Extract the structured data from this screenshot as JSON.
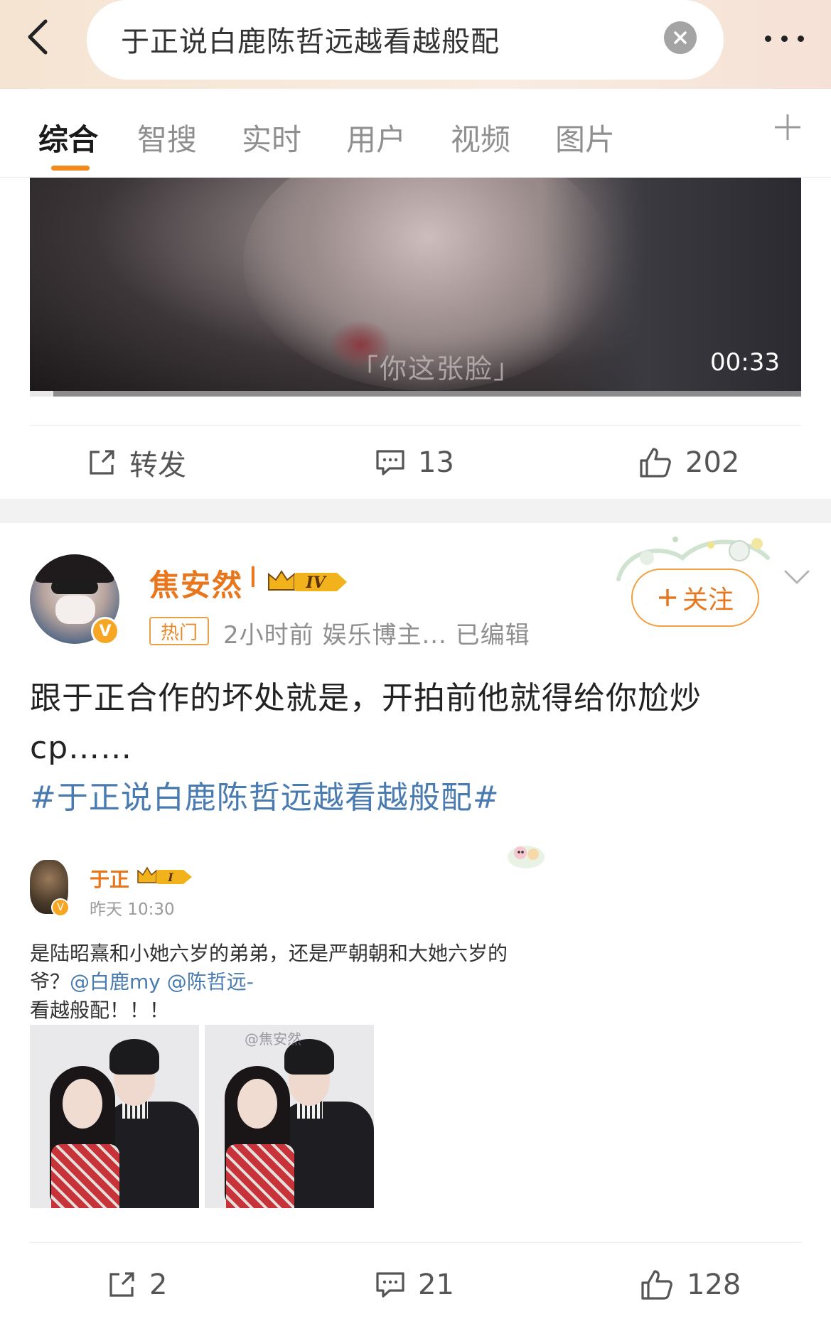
{
  "header": {
    "search_query": "于正说白鹿陈哲远越看越般配",
    "back_icon": "chevron-left-icon",
    "clear_icon": "close-icon",
    "more_icon": "more-dots-icon"
  },
  "tabs": {
    "items": [
      {
        "label": "综合",
        "active": true
      },
      {
        "label": "智搜",
        "active": false
      },
      {
        "label": "实时",
        "active": false
      },
      {
        "label": "用户",
        "active": false
      },
      {
        "label": "视频",
        "active": false
      },
      {
        "label": "图片",
        "active": false
      }
    ],
    "add_icon": "plus-icon",
    "accent_color": "#f28b1e"
  },
  "video": {
    "subtitle": "「你这张脸」",
    "duration": "00:33",
    "progress": 0.03
  },
  "post1_actions": {
    "repost_label": "转发",
    "comments": "13",
    "likes": "202"
  },
  "post2": {
    "username": "焦安然",
    "username_suffix": "I",
    "vip_level": "IV",
    "hot_badge": "热门",
    "meta": "2小时前  娱乐博主...  已编辑",
    "follow_label": "关注",
    "text": "跟于正合作的坏处就是，开拍前他就得给你尬炒cp……",
    "hashtag": "#于正说白鹿陈哲远越看越般配#",
    "embed": {
      "name": "于正",
      "vip_level": "I",
      "time": "昨天 10:30",
      "line1": "是陆昭熹和小她六岁的弟弟，还是严朝朝和大她六岁的",
      "line2_prefix": "爷？",
      "line2_mentions": "@白鹿my @陈哲远-",
      "line3": "看越般配！！！",
      "watermark": "@焦安然"
    },
    "actions": {
      "reposts": "2",
      "comments": "21",
      "likes": "128"
    }
  }
}
